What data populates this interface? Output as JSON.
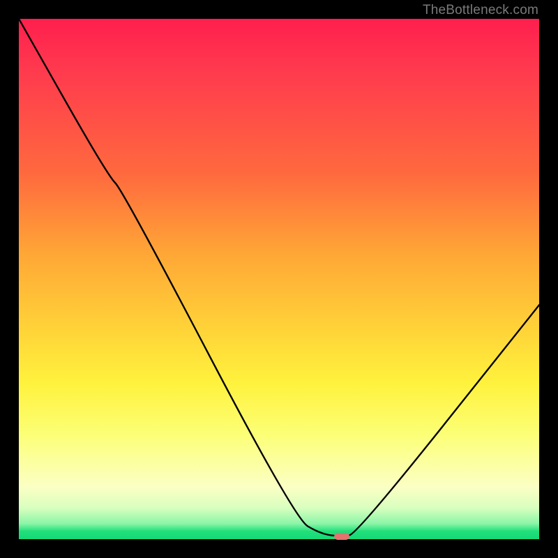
{
  "watermark": "TheBottleneck.com",
  "chart_data": {
    "type": "line",
    "title": "",
    "xlabel": "",
    "ylabel": "",
    "xlim": [
      0,
      100
    ],
    "ylim": [
      0,
      100
    ],
    "series": [
      {
        "name": "bottleneck-curve",
        "x": [
          0,
          17,
          20,
          53,
          58,
          62,
          65,
          100
        ],
        "values": [
          100,
          70,
          67,
          4,
          1,
          0.5,
          1,
          45
        ]
      }
    ],
    "marker": {
      "x": 62,
      "y": 0.5,
      "color": "#e3736e"
    },
    "gradient_stops": [
      {
        "pos": 0,
        "color": "#ff1f4e"
      },
      {
        "pos": 0.7,
        "color": "#fff23d"
      },
      {
        "pos": 0.98,
        "color": "#1fe07a"
      }
    ]
  }
}
